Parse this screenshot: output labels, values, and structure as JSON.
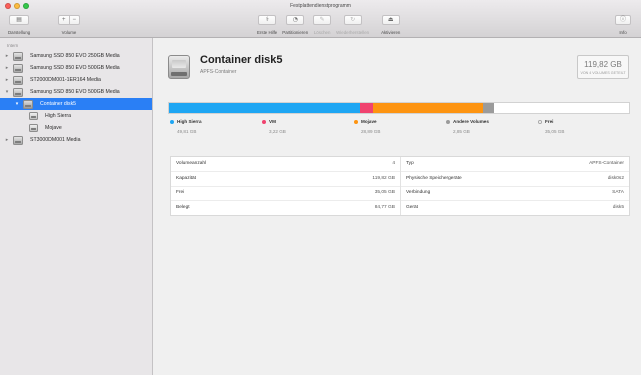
{
  "window": {
    "title": "Festplattendienstprogramm"
  },
  "toolbar": {
    "view": {
      "label": "Darstellung",
      "icon": "sidebar-toggle-icon"
    },
    "volume": {
      "label": "Volume",
      "add": "+",
      "remove": "−"
    },
    "actions": [
      {
        "label": "Erste Hilfe",
        "icon": "stethoscope-icon",
        "enabled": true
      },
      {
        "label": "Partitionieren",
        "icon": "pie-chart-icon",
        "enabled": true
      },
      {
        "label": "Löschen",
        "icon": "eraser-icon",
        "enabled": false
      },
      {
        "label": "Wiederherstellen",
        "icon": "restore-icon",
        "enabled": false
      },
      {
        "label": "Aktivieren",
        "icon": "eject-icon",
        "enabled": true
      }
    ],
    "info": {
      "label": "Info",
      "icon": "info-icon"
    }
  },
  "sidebar": {
    "section_label": "Intern",
    "items": [
      {
        "label": "Samsung SSD 850 EVO 250GB Media",
        "level": 0,
        "expanded": false,
        "icon": "internal-disk-icon"
      },
      {
        "label": "Samsung SSD 850 EVO 500GB Media",
        "level": 0,
        "expanded": false,
        "icon": "internal-disk-icon"
      },
      {
        "label": "ST2000DM001-1ER164 Media",
        "level": 0,
        "expanded": false,
        "icon": "internal-disk-icon"
      },
      {
        "label": "Samsung SSD 850 EVO 500GB Media",
        "level": 0,
        "expanded": true,
        "icon": "internal-disk-icon"
      },
      {
        "label": "Container disk5",
        "level": 1,
        "expanded": true,
        "selected": true,
        "icon": "container-icon"
      },
      {
        "label": "High Sierra",
        "level": 2,
        "icon": "volume-icon"
      },
      {
        "label": "Mojave",
        "level": 2,
        "icon": "volume-icon"
      },
      {
        "label": "ST3000DM001 Media",
        "level": 0,
        "expanded": false,
        "icon": "internal-disk-icon"
      }
    ]
  },
  "detail": {
    "icon": "container-disk-icon",
    "name": "Container disk5",
    "subtitle": "APFS-Container",
    "capacity": "119,82 GB",
    "capacity_note": "VON 4 VOLUMES GETEILT"
  },
  "usage": {
    "segments": [
      {
        "name": "High Sierra",
        "value": "49,81 GB",
        "amount": 49.81,
        "color": "#1ea6f3"
      },
      {
        "name": "VM",
        "value": "3,22 GB",
        "amount": 3.22,
        "color": "#f0436f"
      },
      {
        "name": "Mojave",
        "value": "28,89 GB",
        "amount": 28.89,
        "color": "#fd9411"
      },
      {
        "name": "Andere Volumes",
        "value": "2,85 GB",
        "amount": 2.85,
        "color": "#9b9b9b"
      },
      {
        "name": "Frei",
        "value": "35,05 GB",
        "amount": 35.05,
        "color": "#ffffff"
      }
    ]
  },
  "info_table": {
    "left": [
      {
        "label": "Volumeanzahl",
        "value": "4"
      },
      {
        "label": "Kapazität",
        "value": "119,82 GB"
      },
      {
        "label": "Frei",
        "value": "35,05 GB"
      },
      {
        "label": "Belegt",
        "value": "84,77 GB"
      }
    ],
    "right": [
      {
        "label": "Typ",
        "value": "APFS-Container"
      },
      {
        "label": "Physische Speichergeräte",
        "value": "disk0s2"
      },
      {
        "label": "Verbindung",
        "value": "SATA"
      },
      {
        "label": "Gerät",
        "value": "disk5"
      }
    ]
  }
}
